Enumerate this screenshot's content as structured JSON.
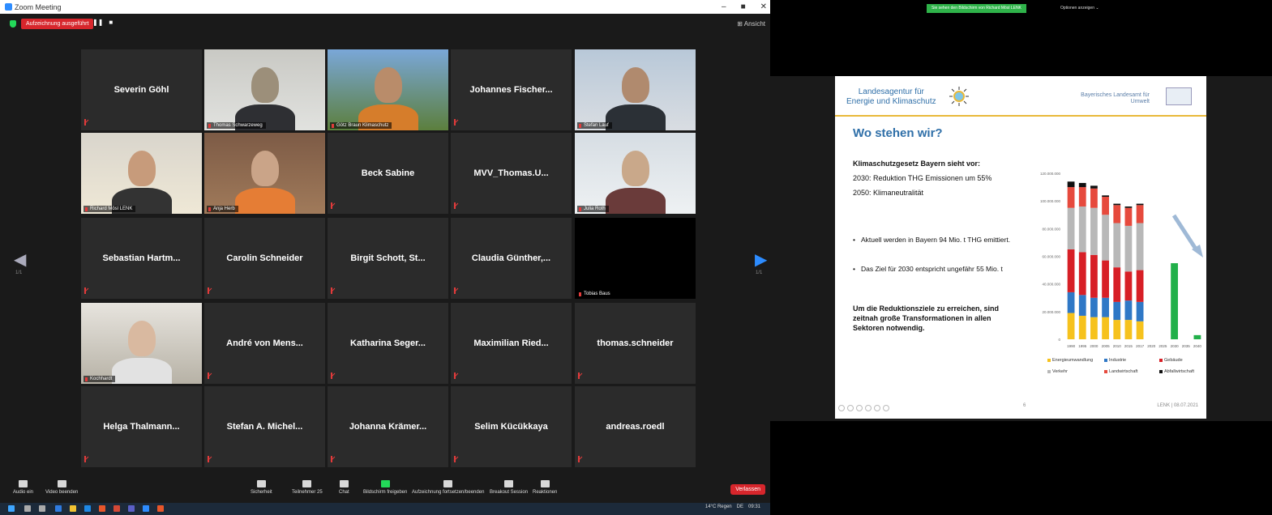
{
  "window": {
    "title": "Zoom Meeting",
    "min": "–",
    "max": "■",
    "close": "✕"
  },
  "topbar": {
    "recording": "Aufzeichnung ausgeführt",
    "pause": "❚❚",
    "stop": "■",
    "view": "⊞ Ansicht"
  },
  "nav": {
    "left": "◀",
    "right": "▶",
    "page_left": "1/1",
    "page_right": "1/1"
  },
  "participants": [
    {
      "name": "Severin Göhl",
      "type": "name"
    },
    {
      "name": "Thomas Schwarzeweg",
      "type": "video"
    },
    {
      "name": "Götz Braun Klimaschutz",
      "type": "video"
    },
    {
      "name": "Johannes Fischer...",
      "type": "name"
    },
    {
      "name": "Stefan Lauf",
      "type": "video"
    },
    {
      "name": "Richard Mösl LENK",
      "type": "video",
      "active": true
    },
    {
      "name": "Anja Herb",
      "type": "video"
    },
    {
      "name": "Beck Sabine",
      "type": "name"
    },
    {
      "name": "MVV_Thomas.U...",
      "type": "name"
    },
    {
      "name": "Julia Roth",
      "type": "video"
    },
    {
      "name": "Sebastian Hartm...",
      "type": "name"
    },
    {
      "name": "Carolin Schneider",
      "type": "name"
    },
    {
      "name": "Birgit Schott, St...",
      "type": "name"
    },
    {
      "name": "Claudia Günther,...",
      "type": "name"
    },
    {
      "name": "Tobias Baus",
      "type": "dark"
    },
    {
      "name": "Kochhardt",
      "type": "video"
    },
    {
      "name": "André von Mens...",
      "type": "name"
    },
    {
      "name": "Katharina Seger...",
      "type": "name"
    },
    {
      "name": "Maximilian Ried...",
      "type": "name"
    },
    {
      "name": "thomas.schneider",
      "type": "name"
    },
    {
      "name": "Helga Thalmann...",
      "type": "name"
    },
    {
      "name": "Stefan A. Michel...",
      "type": "name"
    },
    {
      "name": "Johanna Krämer...",
      "type": "name"
    },
    {
      "name": "Selim Kücükkaya",
      "type": "name"
    },
    {
      "name": "andreas.roedl",
      "type": "name"
    }
  ],
  "toolbar": {
    "audio": "Audio ein",
    "video": "Video beenden",
    "security": "Sicherheit",
    "participants": "Teilnehmer",
    "participants_count": "25",
    "chat": "Chat",
    "share": "Bildschirm freigeben",
    "record": "Aufzeichnung fortsetzen/beenden",
    "breakout": "Breakout Session",
    "reactions": "Reaktionen",
    "end": "Verlassen"
  },
  "taskbar": {
    "weather": "14°C Regen",
    "time": "09:31",
    "lang": "DE"
  },
  "share": {
    "banner": "Sie sehen den Bildschirm von Richard Mösl LENK",
    "options": "Optionen anzeigen ⌄"
  },
  "slide": {
    "agency_line1": "Landesagentur für",
    "agency_line2": "Energie und Klimaschutz",
    "lfu_line1": "Bayerisches Landesamt für",
    "lfu_line2": "Umwelt",
    "title": "Wo stehen wir?",
    "kg_head": "Klimaschutzgesetz Bayern sieht vor:",
    "kg_2030": "2030: Reduktion THG Emissionen um 55%",
    "kg_2050": "2050: Klimaneutralität",
    "bullet1": "Aktuell werden in Bayern 94 Mio. t THG emittiert.",
    "bullet2": "Das Ziel für 2030 entspricht ungefähr 55 Mio. t",
    "goal": "Um die Reduktionsziele zu erreichen, sind zeitnah große Transformationen in allen Sektoren notwendig.",
    "number": "6",
    "footer": "LENK | 08.07.2021"
  },
  "colors": {
    "energy": "#f6c21d",
    "industry": "#2f78c6",
    "buildings": "#d71f26",
    "traffic": "#b8b8b8",
    "agriculture": "#e64a3d",
    "waste": "#101010",
    "target": "#22b04a"
  },
  "chart_data": {
    "type": "bar",
    "stacked": true,
    "categories": [
      "1990",
      "1995",
      "2000",
      "2005",
      "2010",
      "2015",
      "2017",
      "2020",
      "2025",
      "2030",
      "2035",
      "2040"
    ],
    "ylim": [
      0,
      120000000
    ],
    "yticks": [
      "0",
      "20.000.000",
      "40.000.000",
      "60.000.000",
      "80.000.000",
      "100.000.000",
      "120.000.000"
    ],
    "series": [
      {
        "name": "Energieumwandlung",
        "color": "#f6c21d",
        "values": [
          19000000,
          17000000,
          16000000,
          16000000,
          14000000,
          14000000,
          13000000,
          0,
          0,
          0,
          0,
          0
        ]
      },
      {
        "name": "Industrie",
        "color": "#2f78c6",
        "values": [
          15000000,
          15000000,
          14000000,
          14000000,
          13000000,
          14000000,
          14000000,
          0,
          0,
          0,
          0,
          0
        ]
      },
      {
        "name": "Gebäude",
        "color": "#d71f26",
        "values": [
          31000000,
          31000000,
          31000000,
          27000000,
          25000000,
          21000000,
          23000000,
          0,
          0,
          0,
          0,
          0
        ]
      },
      {
        "name": "Verkehr",
        "color": "#b8b8b8",
        "values": [
          30000000,
          33000000,
          34000000,
          33000000,
          32000000,
          33000000,
          34000000,
          0,
          0,
          0,
          0,
          0
        ]
      },
      {
        "name": "Landwirtschaft",
        "color": "#e64a3d",
        "values": [
          15000000,
          14000000,
          14000000,
          13000000,
          13000000,
          13000000,
          13000000,
          0,
          0,
          0,
          0,
          0
        ]
      },
      {
        "name": "Abfallwirtschaft",
        "color": "#101010",
        "values": [
          4000000,
          3000000,
          2000000,
          1000000,
          1000000,
          1000000,
          1000000,
          0,
          0,
          0,
          0,
          0
        ]
      },
      {
        "name": "",
        "color": "#22b04a",
        "values": [
          0,
          0,
          0,
          0,
          0,
          0,
          0,
          0,
          0,
          55000000,
          0,
          3000000
        ]
      }
    ]
  }
}
